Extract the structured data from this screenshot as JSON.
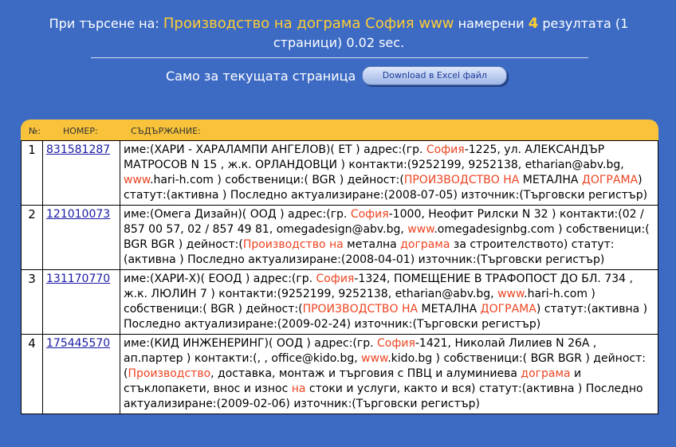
{
  "header": {
    "prefix": "При търсене на:",
    "query": "Производство на дограма София www",
    "found_label": "намерени",
    "count": "4",
    "suffix": "резултата (1 страници) 0.02 sec."
  },
  "excel": {
    "label": "Само за текущата страница",
    "button_label": "Download в Excel файл"
  },
  "table": {
    "columns": [
      "№:",
      "НОМЕР:",
      "СЪДЪРЖАНИЕ:"
    ],
    "rows": [
      {
        "num": "1",
        "id": "831581287",
        "parts": [
          {
            "t": "име:(ХАРИ - ХАРАЛАМПИ АНГЕЛОВ)( ЕТ ) адрес:(гр. ",
            "h": false
          },
          {
            "t": "София",
            "h": true
          },
          {
            "t": "-1225, ул. АЛЕКСАНДЪР МАТРОСОВ N 15 , ж.к. ОРЛАНДОВЦИ ) контакти:(9252199, 9252138, etharian@abv.bg, ",
            "h": false
          },
          {
            "t": "www",
            "h": true
          },
          {
            "t": ".hari-h.com ) собственици:( BGR ) дейност:(",
            "h": false
          },
          {
            "t": "ПРОИЗВОДСТВО НА",
            "h": true
          },
          {
            "t": " МЕТАЛНА ",
            "h": false
          },
          {
            "t": "ДОГРАМА",
            "h": true
          },
          {
            "t": ") статут:(активна ) Последно актуализиране:(2008-07-05) източник:(Търговски регистър)",
            "h": false
          }
        ]
      },
      {
        "num": "2",
        "id": "121010073",
        "parts": [
          {
            "t": "име:(Омега Дизайн)( ООД ) адрес:(гр. ",
            "h": false
          },
          {
            "t": "София",
            "h": true
          },
          {
            "t": "-1000, Неофит Рилски N 32 ) контакти:(02 / 857 00 57, 02 / 857 49 81, omegadesign@abv.bg, ",
            "h": false
          },
          {
            "t": "www",
            "h": true
          },
          {
            "t": ".omegadesignbg.com ) собственици:( BGR BGR ) дейност:(",
            "h": false
          },
          {
            "t": "Производство на",
            "h": true
          },
          {
            "t": " метална ",
            "h": false
          },
          {
            "t": "дограма",
            "h": true
          },
          {
            "t": " за строителството) статут:(активна ) Последно актуализиране:(2008-04-01) източник:(Търговски регистър)",
            "h": false
          }
        ]
      },
      {
        "num": "3",
        "id": "131170770",
        "parts": [
          {
            "t": "име:(ХАРИ-Х)( ЕООД ) адрес:(гр. ",
            "h": false
          },
          {
            "t": "София",
            "h": true
          },
          {
            "t": "-1324, ПОМЕЩЕНИЕ В ТРАФОПОСТ ДО БЛ. 734 , ж.к. ЛЮЛИН 7 ) контакти:(9252199, 9252138, etharian@abv.bg, ",
            "h": false
          },
          {
            "t": "www",
            "h": true
          },
          {
            "t": ".hari-h.com ) собственици:( BGR ) дейност:(",
            "h": false
          },
          {
            "t": "ПРОИЗВОДСТВО НА",
            "h": true
          },
          {
            "t": " МЕТАЛНА ",
            "h": false
          },
          {
            "t": "ДОГРАМА",
            "h": true
          },
          {
            "t": ") статут:(активна ) Последно актуализиране:(2009-02-24) източник:(Търговски регистър)",
            "h": false
          }
        ]
      },
      {
        "num": "4",
        "id": "175445570",
        "parts": [
          {
            "t": "име:(КИД ИНЖЕНЕРИНГ)( ООД ) адрес:(гр. ",
            "h": false
          },
          {
            "t": "София",
            "h": true
          },
          {
            "t": "-1421, Николай Лилиев N 26А , ап.партер ) контакти:(, , office@kido.bg, ",
            "h": false
          },
          {
            "t": "www",
            "h": true
          },
          {
            "t": ".kido.bg ) собственици:( BGR BGR ) дейност:(",
            "h": false
          },
          {
            "t": "Производство",
            "h": true
          },
          {
            "t": ", доставка, монтаж и търговия с ПВЦ и алуминиева ",
            "h": false
          },
          {
            "t": "дограма",
            "h": true
          },
          {
            "t": " и стъклопакети, внос и износ ",
            "h": false
          },
          {
            "t": "на",
            "h": true
          },
          {
            "t": " стоки и услуги, както и вся) статут:(активна ) Последно актуализиране:(2009-02-06) източник:(Търговски регистър)",
            "h": false
          }
        ]
      }
    ]
  }
}
